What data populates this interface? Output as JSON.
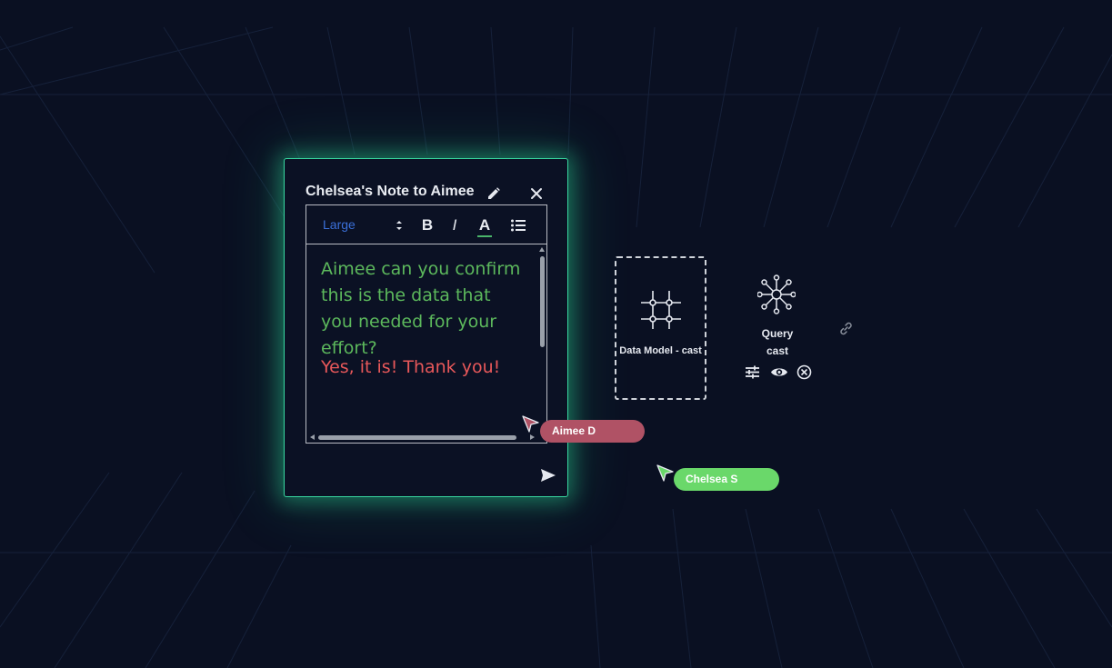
{
  "note": {
    "title": "Chelsea's Note to Aimee",
    "editor": {
      "font_size_option": "Large",
      "toolbar": {
        "bold_label": "B",
        "italic_label": "I",
        "color_label": "A",
        "list_icon": "bulleted-list-icon"
      },
      "paragraphs": [
        {
          "text": "Aimee can you confirm this is the data that you needed for your effort?",
          "color": "#5cb85c"
        },
        {
          "text": "Yes, it is! Thank you!",
          "color": "#e8585a"
        }
      ]
    },
    "icons": {
      "edit": "pencil-icon",
      "close": "close-icon",
      "send": "send-icon"
    }
  },
  "data_model_node": {
    "label": "Data Model - cast",
    "icon": "grid-icon"
  },
  "query_node": {
    "title": "Query",
    "subtitle": "cast",
    "icon": "network-hub-icon",
    "actions": [
      "sliders-icon",
      "eye-icon",
      "circle-x-icon"
    ]
  },
  "link_icon": "link-icon",
  "collaborators": [
    {
      "name": "Aimee D",
      "color": "#b05265"
    },
    {
      "name": "Chelsea S",
      "color": "#6ad86a"
    }
  ],
  "colors": {
    "background": "#0a1022",
    "card_glow": "#38d7a0",
    "accent_blue": "#3a6fd8"
  }
}
